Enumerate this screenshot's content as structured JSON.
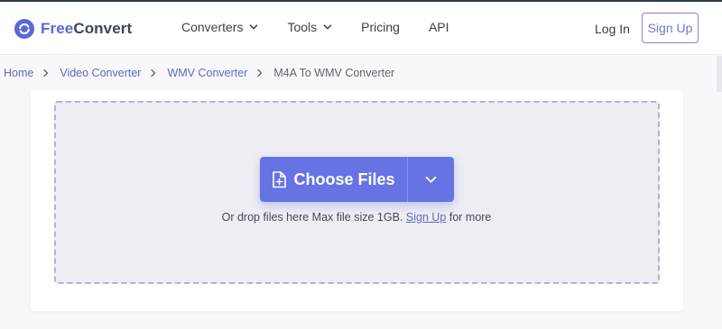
{
  "brand": {
    "name_part1": "Free",
    "name_part2": "Convert",
    "logo_icon": "refresh-circle-icon",
    "accent": "#5a67d8"
  },
  "nav": {
    "items": [
      {
        "label": "Converters",
        "has_dropdown": true
      },
      {
        "label": "Tools",
        "has_dropdown": true
      },
      {
        "label": "Pricing",
        "has_dropdown": false
      },
      {
        "label": "API",
        "has_dropdown": false
      }
    ],
    "login": "Log In",
    "signup": "Sign Up"
  },
  "breadcrumb": {
    "items": [
      "Home",
      "Video Converter",
      "WMV Converter"
    ],
    "current": "M4A To WMV Converter"
  },
  "upload": {
    "button_label": "Choose Files",
    "note_prefix": "Or drop files here Max file size 1GB.",
    "note_link": "Sign Up",
    "note_suffix": "for more",
    "button_color": "#6773e3"
  }
}
